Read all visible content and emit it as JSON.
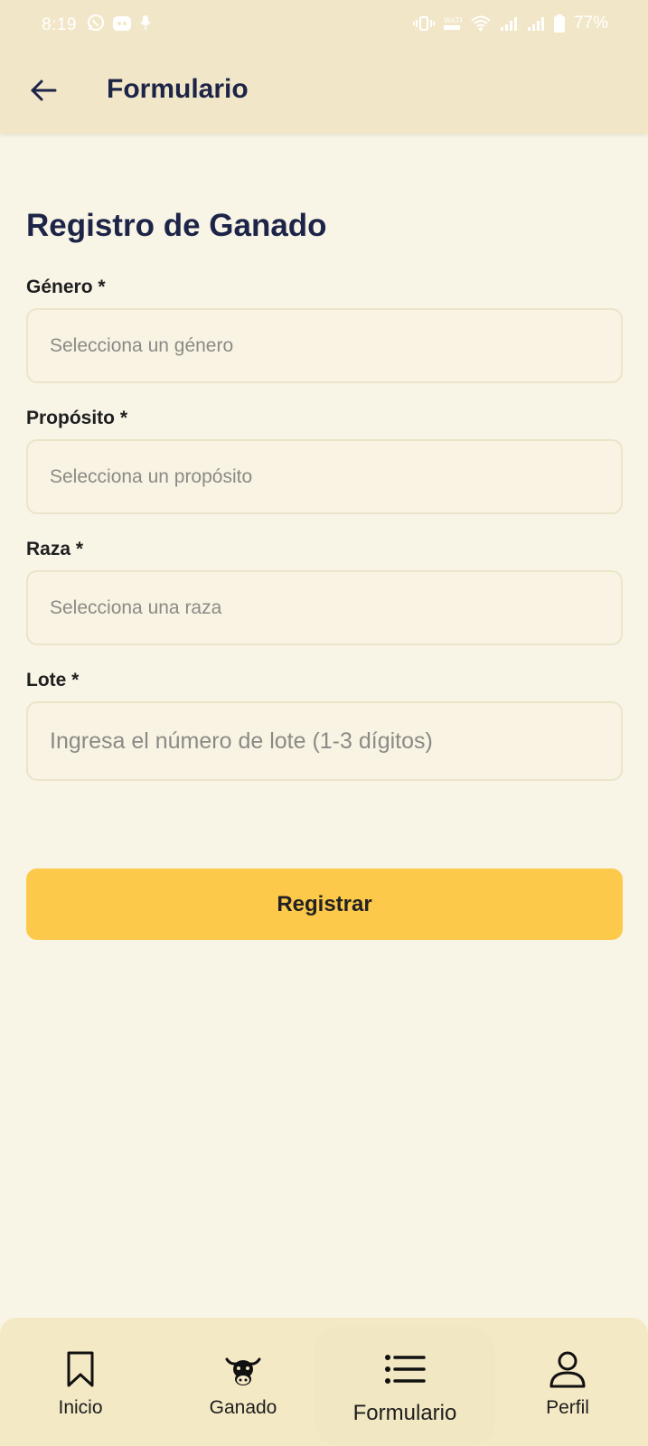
{
  "status_bar": {
    "time": "8:19",
    "battery": "77%",
    "icons": [
      "whatsapp-icon",
      "cat-app-icon",
      "mic-icon",
      "vibrate-icon",
      "volte-icon",
      "wifi-icon",
      "signal-icon",
      "signal-icon",
      "battery-icon"
    ]
  },
  "app_bar": {
    "title": "Formulario",
    "back_icon": "arrow-left-icon"
  },
  "form": {
    "title": "Registro de Ganado",
    "fields": [
      {
        "label": "Género *",
        "placeholder": "Selecciona un género"
      },
      {
        "label": "Propósito *",
        "placeholder": "Selecciona un propósito"
      },
      {
        "label": "Raza *",
        "placeholder": "Selecciona una raza"
      },
      {
        "label": "Lote *",
        "placeholder": "Ingresa el número de lote (1-3 dígitos)"
      }
    ],
    "submit_label": "Registrar"
  },
  "bottom_nav": {
    "items": [
      {
        "label": "Inicio",
        "icon": "bookmark-icon"
      },
      {
        "label": "Ganado",
        "icon": "cow-icon"
      },
      {
        "label": "Formulario",
        "icon": "list-icon",
        "active": true
      },
      {
        "label": "Perfil",
        "icon": "person-icon"
      }
    ]
  },
  "colors": {
    "background": "#f8f4e6",
    "app_bar": "#f1e7c8",
    "title_text": "#1d2448",
    "input_bg": "#f9f3e3",
    "input_border": "#ece4ca",
    "button": "#fdc94a",
    "bottom_nav": "#f4e9c5"
  }
}
